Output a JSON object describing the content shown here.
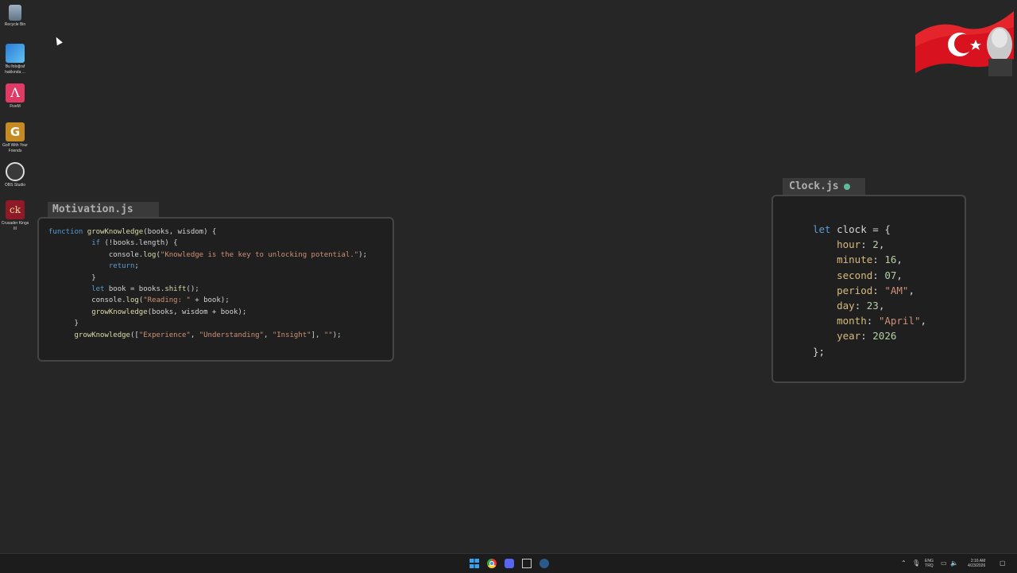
{
  "desktop": {
    "icons": [
      {
        "label": "Recycle Bin",
        "icon": "recycle-bin-icon"
      },
      {
        "label": "Bu fotoğraf hakkında ...",
        "icon": "photo-info-icon"
      },
      {
        "label": "FiveM",
        "icon": "fivem-icon",
        "glyph": "Λ"
      },
      {
        "label": "Golf With Your Friends",
        "icon": "golf-icon",
        "glyph": "G"
      },
      {
        "label": "OBS Studio",
        "icon": "obs-icon"
      },
      {
        "label": "Crusader Kings III",
        "icon": "crusader-kings-icon",
        "glyph": "ck"
      }
    ]
  },
  "motivation": {
    "tab_title": "Motivation.js",
    "code": {
      "l1_kw": "function",
      "l1_fn": "growKnowledge",
      "l1_rest": "(books, wisdom) {",
      "l2_kw": "if",
      "l2_rest": " (!books.length) {",
      "l3_a": "console.",
      "l3_fn": "log",
      "l3_b": "(",
      "l3_str": "\"Knowledge is the key to unlocking potential.\"",
      "l3_c": ");",
      "l4_kw": "return",
      "l4_rest": ";",
      "l5": "}",
      "l6_kw": "let",
      "l6_rest": " book = books.",
      "l6_fn": "shift",
      "l6_end": "();",
      "l7_a": "console.",
      "l7_fn": "log",
      "l7_b": "(",
      "l7_str": "\"Reading: \"",
      "l7_c": " + book);",
      "l8_fn": "growKnowledge",
      "l8_rest": "(books, wisdom + book);",
      "l9": "}",
      "l10_fn": "growKnowledge",
      "l10_a": "([",
      "l10_s1": "\"Experience\"",
      "l10_s2": "\"Understanding\"",
      "l10_s3": "\"Insight\"",
      "l10_s4": "\"\"",
      "l10_b": "], ",
      "l10_end": ");"
    }
  },
  "clock": {
    "tab_title": "Clock.js",
    "kw_let": "let",
    "var_name": "clock",
    "open": " = {",
    "fields": {
      "hour_key": "hour",
      "hour_val": "2",
      "minute_key": "minute",
      "minute_val": "16",
      "second_key": "second",
      "second_val": "07",
      "period_key": "period",
      "period_val": "\"AM\"",
      "day_key": "day",
      "day_val": "23",
      "month_key": "month",
      "month_val": "\"April\"",
      "year_key": "year",
      "year_val": "2026"
    },
    "close": "};"
  },
  "taskbar": {
    "apps": [
      "windows-start-icon",
      "chrome-icon",
      "discord-icon",
      "app-icon",
      "steam-icon"
    ],
    "tray": {
      "lang_top": "ENG",
      "lang_bottom": "TRQ",
      "time": "2:16 AM",
      "date": "4/23/2026"
    }
  },
  "colors": {
    "background": "#262626",
    "keyword": "#569cd6",
    "function": "#dcdcaa",
    "string": "#ce9178",
    "number": "#b5cea8",
    "status_dot": "#5fb89a"
  }
}
